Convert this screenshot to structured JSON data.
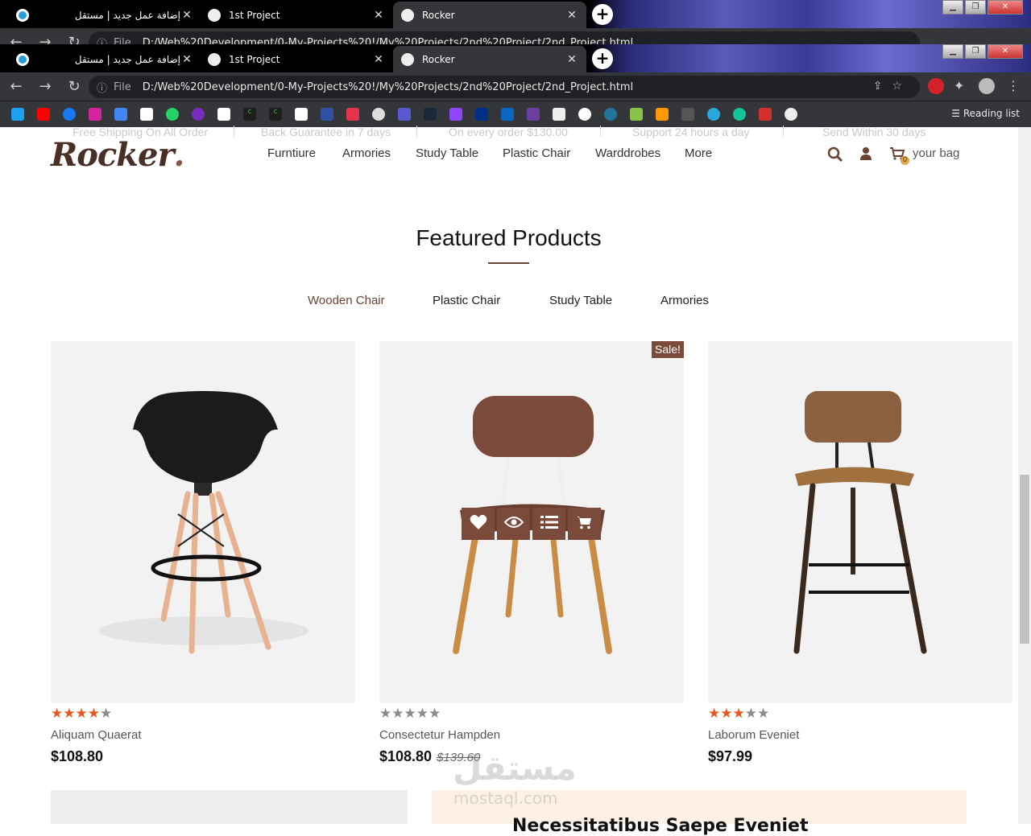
{
  "browser": {
    "tabs": [
      {
        "label": "إضافة عمل جديد | مستقل"
      },
      {
        "label": "1st Project"
      },
      {
        "label": "Rocker"
      }
    ],
    "url_scheme": "File",
    "url": "D:/Web%20Development/0-My-Projects%20!/My%20Projects/2nd%20Project/2nd_Project.html",
    "reading_list": "Reading list"
  },
  "topbar": [
    "Free Shipping On All Order",
    "Back Guarantee in 7 days",
    "On every order $130.00",
    "Support 24 hours a day",
    "Send Within 30 days"
  ],
  "logo": {
    "main": "Rocker",
    "dot": "."
  },
  "nav": [
    "Furntiure",
    "Armories",
    "Study Table",
    "Plastic Chair",
    "Warddrobes",
    "More"
  ],
  "header": {
    "bag_label": "your bag",
    "bag_count": "0"
  },
  "section": {
    "title": "Featured Products"
  },
  "filters": [
    {
      "label": "Wooden Chair",
      "active": true
    },
    {
      "label": "Plastic Chair",
      "active": false
    },
    {
      "label": "Study Table",
      "active": false
    },
    {
      "label": "Armories",
      "active": false
    }
  ],
  "products": [
    {
      "name": "Aliquam Quaerat",
      "price": "$108.80",
      "old_price": "",
      "stars": 4,
      "sale": ""
    },
    {
      "name": "Consectetur Hampden",
      "price": "$108.80",
      "old_price": "$139.60",
      "stars": 0,
      "sale": "Sale!"
    },
    {
      "name": "Laborum Eveniet",
      "price": "$97.99",
      "old_price": "",
      "stars": 3,
      "sale": ""
    }
  ],
  "product_actions": [
    "heart-icon",
    "eye-icon",
    "list-icon",
    "cart-icon"
  ],
  "watermark": {
    "arabic": "مستقل",
    "latin": "mostaql.com"
  },
  "next_section": {
    "heading": "Necessitatibus Saepe Eveniet"
  },
  "colors": {
    "accent": "#6a4233",
    "star": "#e8571e",
    "sale_bg": "#7a4b3a",
    "card_bg": "#f2f2f2"
  }
}
